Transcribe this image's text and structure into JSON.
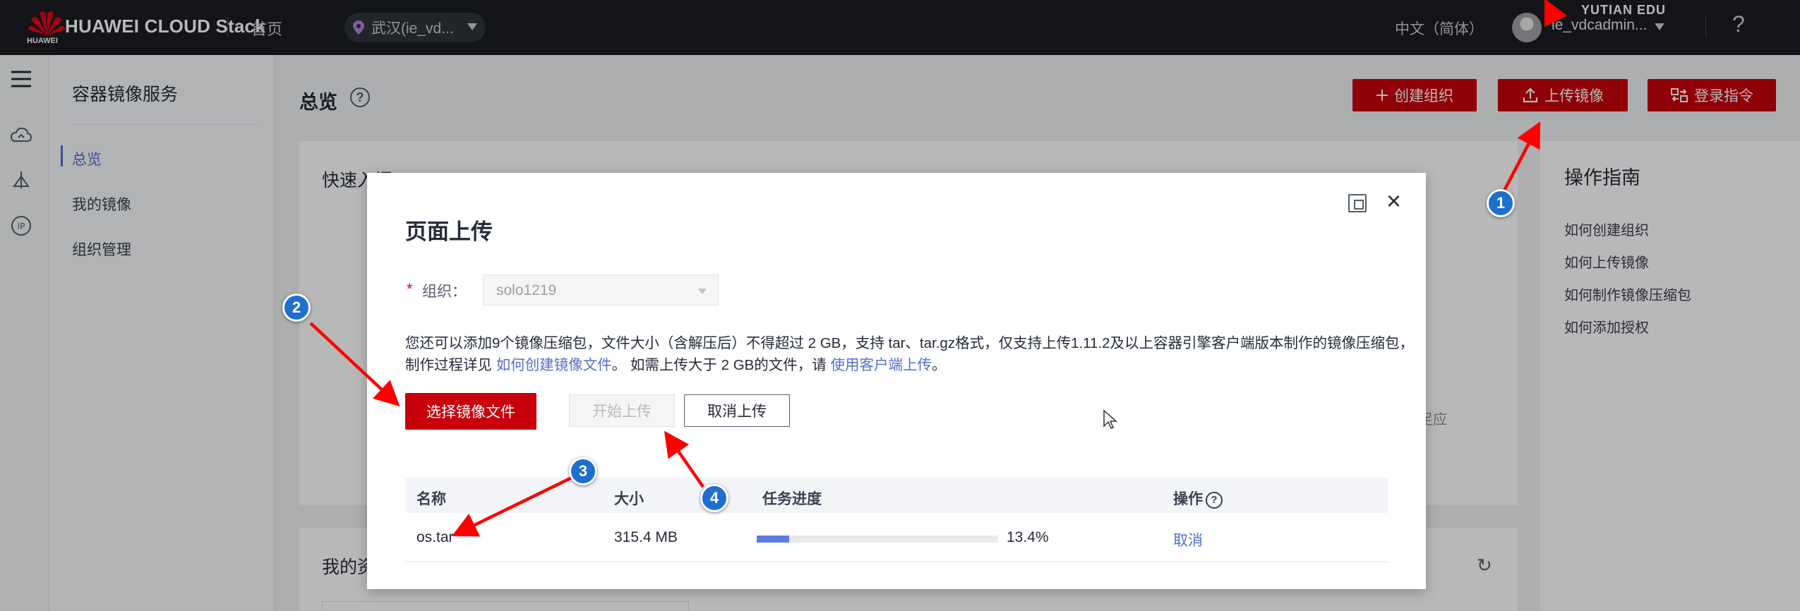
{
  "topbar": {
    "brand": "HUAWEI CLOUD Stack",
    "brand_sub": "HUAWEI",
    "home": "首页",
    "region": "武汉(ie_vd...",
    "language": "中文（简体）",
    "user": "ie_vdcadmin...",
    "help": "?",
    "watermark": "YUTIAN EDU"
  },
  "sidebar": {
    "title": "容器镜像服务",
    "items": [
      {
        "label": "总览",
        "active": true
      },
      {
        "label": "我的镜像",
        "active": false
      },
      {
        "label": "组织管理",
        "active": false
      }
    ]
  },
  "rail_icons": [
    "cloud-icon",
    "deploy-icon",
    "ip-icon"
  ],
  "page": {
    "title": "总览",
    "buttons": {
      "create_org": "创建组织",
      "upload_image": "上传镜像",
      "login_cmd": "登录指令"
    },
    "quick_entry": "快速入门",
    "my_resources": "我的资",
    "bg_fragment": "足应",
    "guide": {
      "title": "操作指南",
      "links": [
        "如何创建组织",
        "如何上传镜像",
        "如何制作镜像压缩包",
        "如何添加授权"
      ]
    }
  },
  "modal": {
    "title": "页面上传",
    "org_required": "*",
    "org_label": "组织：",
    "org_value": "solo1219",
    "desc_part1": "您还可以添加9个镜像压缩包，文件大小（含解压后）不得超过 2 GB，支持 tar、tar.gz格式，仅支持上传1.11.2及以上容器引擎客户端版本制作的镜像压缩包，制作过程详见 ",
    "desc_link1": "如何创建镜像文件",
    "desc_part2": "。 如需上传大于 2 GB的文件，请 ",
    "desc_link2": "使用客户端上传",
    "desc_part3": "。",
    "btn_select": "选择镜像文件",
    "btn_start": "开始上传",
    "btn_cancel": "取消上传",
    "columns": [
      "名称",
      "大小",
      "任务进度",
      "操作"
    ],
    "row": {
      "name": "os.tar",
      "size": "315.4 MB",
      "progress": 0.134,
      "progress_label": "13.4%",
      "action": "取消"
    }
  },
  "annotations": {
    "badges": [
      "1",
      "2",
      "3",
      "4"
    ],
    "arrow_color": "#ff0000",
    "badge_color": "#1e6fce"
  },
  "colors": {
    "brand_red": "#c7000b",
    "link_blue": "#526ecc",
    "progress_blue": "#5e7ce0",
    "topbar_bg": "#1b1d21"
  }
}
